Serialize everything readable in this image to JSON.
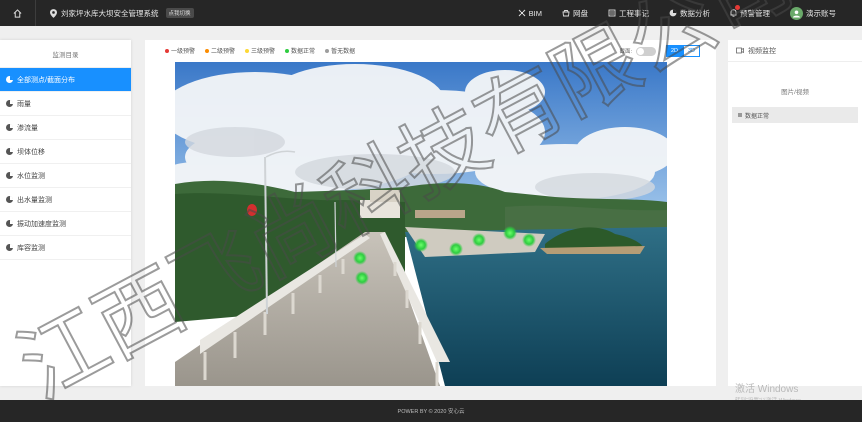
{
  "topbar": {
    "title": "刘家坪水库大坝安全管理系统",
    "switch_label": "点我切换",
    "nav": [
      {
        "label": "BIM",
        "icon": "bim-icon"
      },
      {
        "label": "网盘",
        "icon": "cloud-drive-icon"
      },
      {
        "label": "工程事记",
        "icon": "notes-icon"
      },
      {
        "label": "数据分析",
        "icon": "chart-icon"
      },
      {
        "label": "预警管理",
        "icon": "bell-icon"
      },
      {
        "label": "演示账号",
        "icon": "avatar-icon"
      }
    ]
  },
  "sidebar": {
    "title": "监测目录",
    "items": [
      {
        "label": "全部测点/截面分布",
        "active": true
      },
      {
        "label": "雨量"
      },
      {
        "label": "渗流量"
      },
      {
        "label": "坝体位移"
      },
      {
        "label": "水位监测"
      },
      {
        "label": "出水量监测"
      },
      {
        "label": "振动加速度监测"
      },
      {
        "label": "库容监测"
      }
    ]
  },
  "legend": [
    {
      "label": "一级预警",
      "color": "#e53935"
    },
    {
      "label": "二级预警",
      "color": "#fb8c00"
    },
    {
      "label": "三级预警",
      "color": "#fdd835"
    },
    {
      "label": "数据正常",
      "color": "#2ecc40"
    },
    {
      "label": "暂无数据",
      "color": "#9e9e9e"
    }
  ],
  "map_controls": {
    "section_label": "截面:",
    "mode_2d": "2D",
    "mode_3d": "3D"
  },
  "right_panel": {
    "header": "视频监控",
    "sub_title": "图片/视频",
    "status": "数据正常"
  },
  "windows_activation": {
    "title": "激活 Windows",
    "hint": "转到“设置”以激活 Windows。"
  },
  "footer": "POWER BY © 2020 安心云",
  "watermark": "江西飞尚科技有限公司"
}
